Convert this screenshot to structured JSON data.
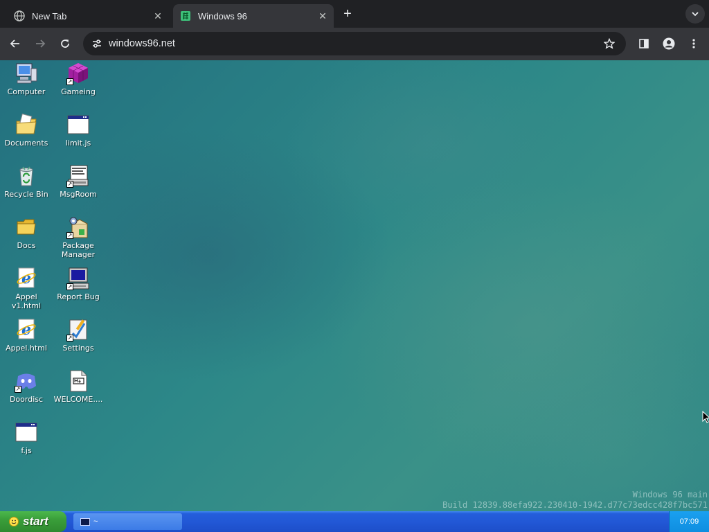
{
  "browser": {
    "tabs": [
      {
        "label": "New Tab",
        "active": false
      },
      {
        "label": "Windows 96",
        "active": true
      }
    ],
    "url": "windows96.net"
  },
  "desktop": {
    "icons": [
      {
        "label": "Computer",
        "icon": "computer-icon"
      },
      {
        "label": "Gameing",
        "icon": "cube-icon"
      },
      {
        "label": "Documents",
        "icon": "documents-folder-icon"
      },
      {
        "label": "limit.js",
        "icon": "window-file-icon"
      },
      {
        "label": "Recycle Bin",
        "icon": "recycle-bin-icon"
      },
      {
        "label": "MsgRoom",
        "icon": "msgroom-icon"
      },
      {
        "label": "Docs",
        "icon": "folder-icon"
      },
      {
        "label": "Package Manager",
        "icon": "package-manager-icon"
      },
      {
        "label": "Appel v1.html",
        "icon": "browser-icon"
      },
      {
        "label": "Report Bug",
        "icon": "computer-monitor-icon"
      },
      {
        "label": "Appel.html",
        "icon": "browser-icon"
      },
      {
        "label": "Settings",
        "icon": "settings-icon"
      },
      {
        "label": "Doordisc",
        "icon": "discord-icon"
      },
      {
        "label": "WELCOME....",
        "icon": "markdown-file-icon"
      },
      {
        "label": "f.js",
        "icon": "window-file-icon"
      }
    ],
    "watermark": {
      "line1": "Windows 96 main",
      "line2": "Build 12839.88efa922.230410-1942.d77c73edcc428f7bc571"
    }
  },
  "taskbar": {
    "start_label": "start",
    "task_label": "~",
    "clock": "07:09"
  },
  "colors": {
    "taskbar": "#245edb",
    "start": "#3a9e3a",
    "desktop": "#2d8888",
    "browser_bg": "#202124",
    "toolbar_bg": "#35363a"
  }
}
